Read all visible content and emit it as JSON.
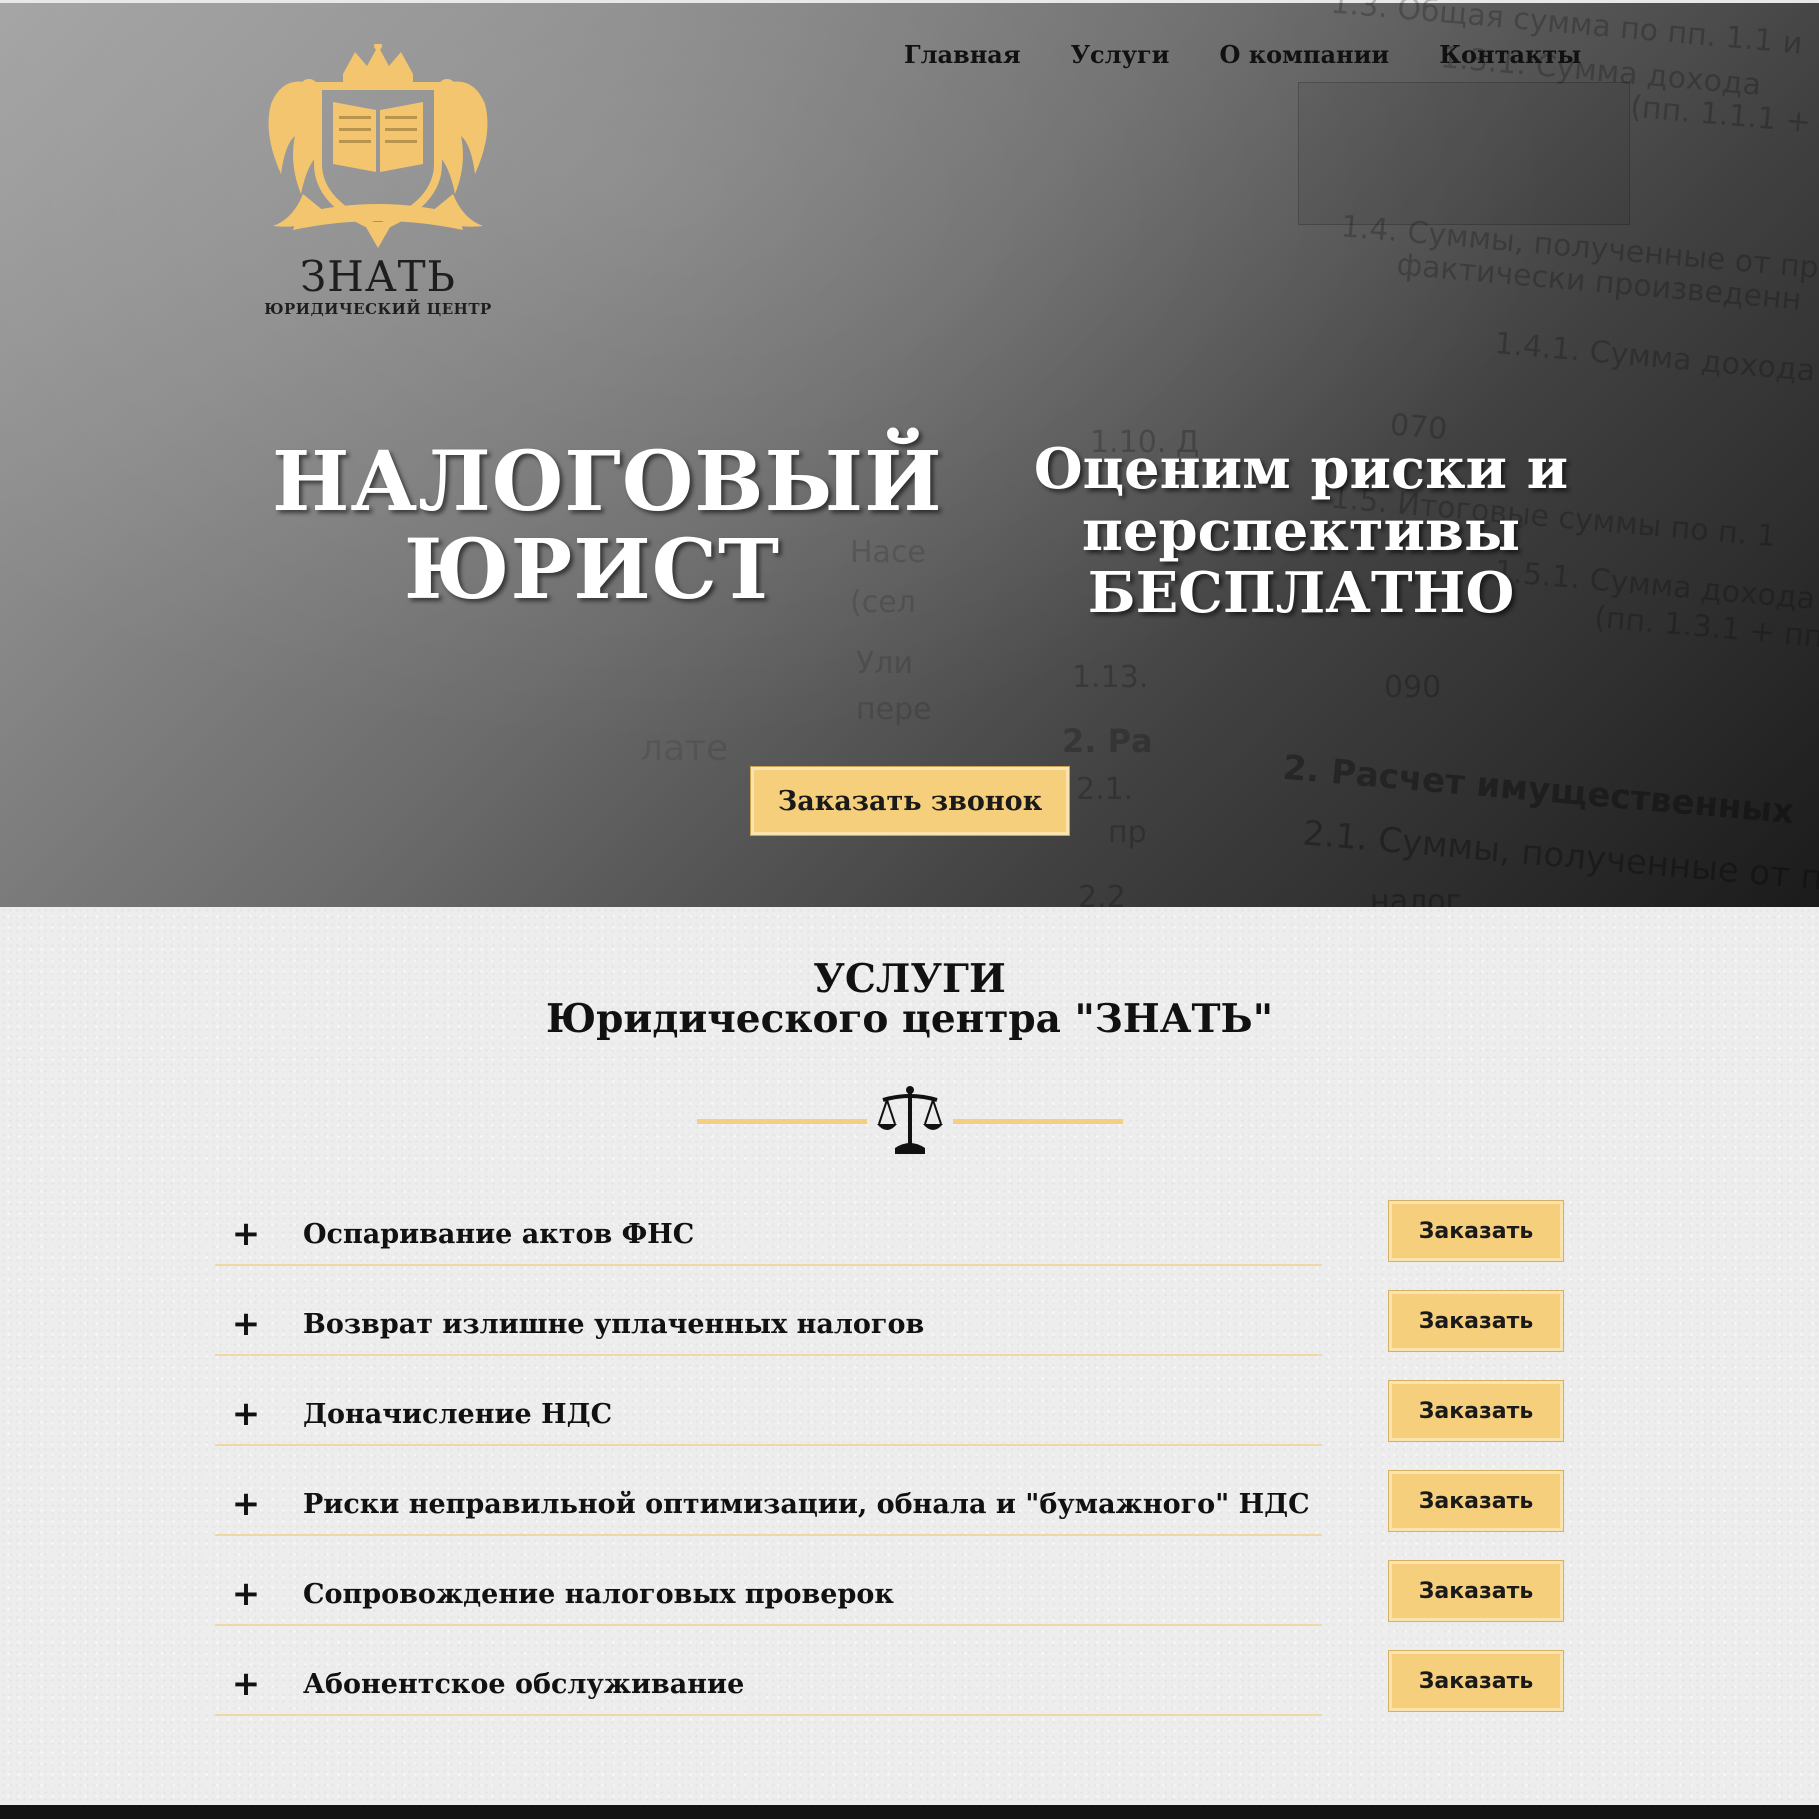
{
  "brand": {
    "name": "ЗНАТЬ",
    "subtitle": "ЮРИДИЧЕСКИЙ ЦЕНТР",
    "emblem_icon": "crest-eagles-book-icon",
    "accent_color": "#f5cf7c"
  },
  "nav": {
    "items": [
      {
        "label": "Главная"
      },
      {
        "label": "Услуги"
      },
      {
        "label": "О компании"
      },
      {
        "label": "Контакты"
      }
    ]
  },
  "hero": {
    "title_line1": "НАЛОГОВЫЙ",
    "title_line2": "ЮРИСТ",
    "subtitle_line1": "Оценим риски и",
    "subtitle_line2": "перспективы",
    "subtitle_line3": "БЕСПЛАТНО",
    "cta_label": "Заказать звонок",
    "background_texts": [
      "1.3. Общая сумма по пп. 1.1 и",
      "1.3.1. Сумма дохода",
      "(пп. 1.1.1 + пп.",
      "1.4. Суммы, полученные от пр",
      "фактически произведенн",
      "1.4.1. Сумма дохода",
      "070",
      "1.5. Итоговые суммы по п. 1",
      "1.5.1. Сумма дохода",
      "(пп. 1.3.1 + пп",
      "1.13.",
      "090",
      "2. Ра",
      "2. Расчет имущественных",
      "2.1. Суммы, полученные от п",
      "2.1.",
      "пр",
      "1.10. Д",
      "Насе",
      "(сел",
      "Ули",
      "пере",
      "лате",
      "налог",
      "2.2"
    ]
  },
  "services": {
    "heading_line1": "УСЛУГИ",
    "heading_line2": "Юридического центра \"ЗНАТЬ\"",
    "divider_icon": "scales-of-justice-icon",
    "items": [
      {
        "label": "Оспаривание актов ФНС",
        "button": "Заказать"
      },
      {
        "label": "Возврат излишне уплаченных налогов",
        "button": "Заказать"
      },
      {
        "label": "Доначисление НДС",
        "button": "Заказать"
      },
      {
        "label": "Риски неправильной оптимизации, обнала и \"бумажного\" НДС",
        "button": "Заказать"
      },
      {
        "label": "Сопровождение налоговых проверок",
        "button": "Заказать"
      },
      {
        "label": "Абонентское обслуживание",
        "button": "Заказать"
      }
    ],
    "expand_icon": "plus-icon"
  }
}
